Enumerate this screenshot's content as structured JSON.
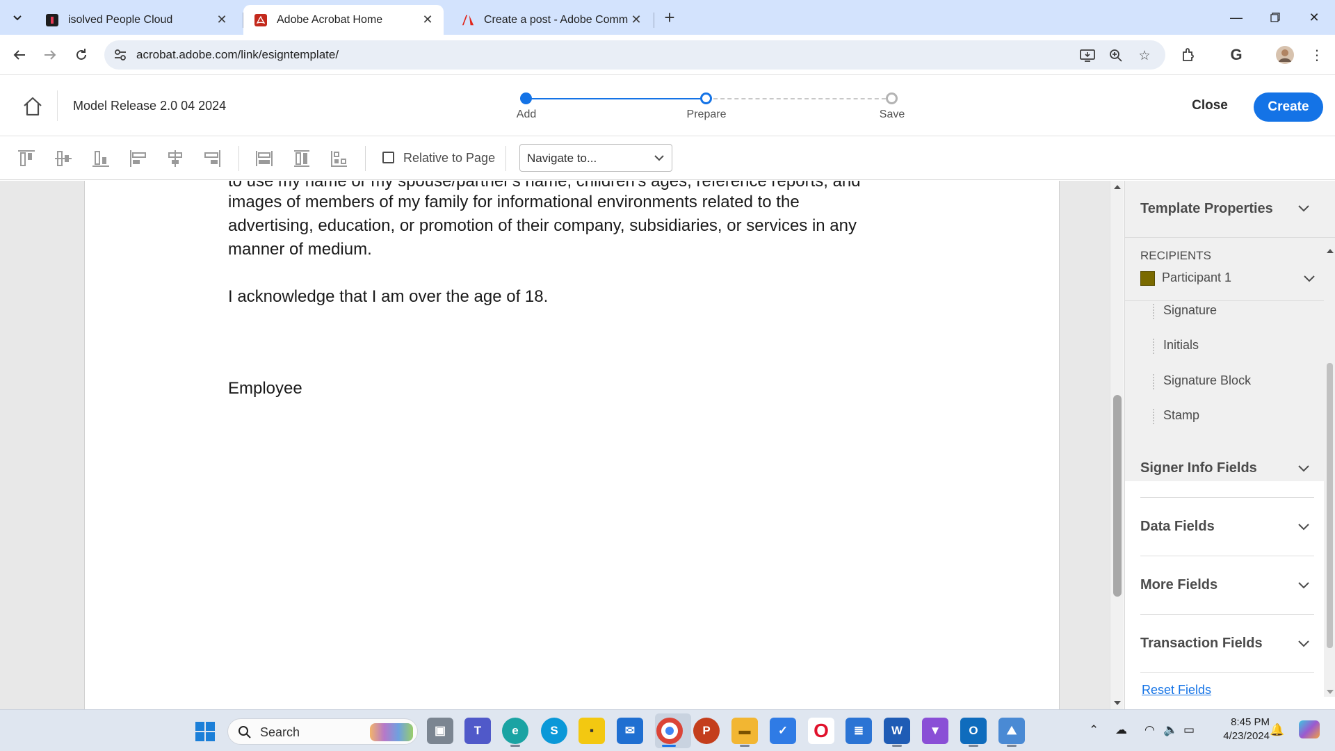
{
  "browser": {
    "tabs": [
      {
        "title": "isolved People Cloud",
        "active": false
      },
      {
        "title": "Adobe Acrobat Home",
        "active": true
      },
      {
        "title": "Create a post - Adobe Commu",
        "active": false
      }
    ],
    "url": "acrobat.adobe.com/link/esigntemplate/"
  },
  "header": {
    "document_title": "Model Release 2.0 04 2024",
    "steps": [
      {
        "label": "Add",
        "state": "complete"
      },
      {
        "label": "Prepare",
        "state": "current"
      },
      {
        "label": "Save",
        "state": "pending"
      }
    ],
    "close_label": "Close",
    "create_label": "Create"
  },
  "align_toolbar": {
    "relative_to_page_label": "Relative to Page",
    "relative_to_page_checked": false,
    "navigate_placeholder": "Navigate to..."
  },
  "document": {
    "cut_line": "to use my name or my spouse/partner's name, children's ages, reference reports, and",
    "paragraph_1": "images of members of my family for informational environments related to the advertising, education, or promotion of their company, subsidiaries, or services in any manner of medium.",
    "line_1": "images of members of my family for informational environments related to the",
    "line_2": "advertising, education, or promotion of their company, subsidiaries, or services in any",
    "line_3": "manner of medium.",
    "paragraph_2": "I acknowledge that I am over the age of 18.",
    "signer_label": "Employee"
  },
  "panel": {
    "template_properties": "Template Properties",
    "recipients_label": "RECIPIENTS",
    "participant": {
      "name": "Participant 1",
      "color": "#7a6a00"
    },
    "signature_fields": [
      "Signature",
      "Initials",
      "Signature Block",
      "Stamp"
    ],
    "sections": [
      "Signer Info Fields",
      "Data Fields",
      "More Fields",
      "Transaction Fields"
    ],
    "reset_label": "Reset Fields"
  },
  "taskbar": {
    "search_label": "Search",
    "time": "8:45 PM",
    "date": "4/23/2024"
  },
  "colors": {
    "accent": "#1473e6",
    "tab_strip": "#d3e3fd",
    "participant": "#7a6a00"
  }
}
